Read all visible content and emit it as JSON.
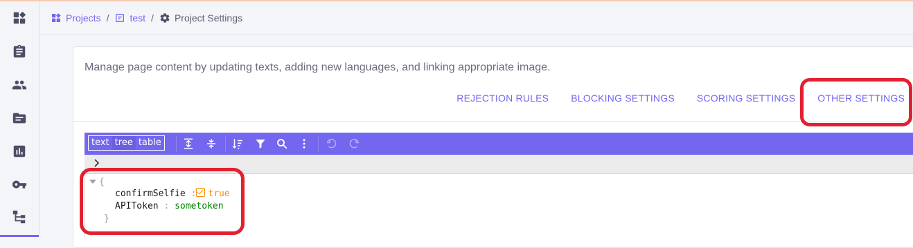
{
  "sidebar": {
    "items": [
      {
        "icon": "dashboard-icon"
      },
      {
        "icon": "clipboard-icon"
      },
      {
        "icon": "users-icon"
      },
      {
        "icon": "folder-icon"
      },
      {
        "icon": "bar-chart-icon"
      },
      {
        "icon": "key-icon"
      },
      {
        "icon": "hierarchy-icon"
      }
    ]
  },
  "breadcrumb": {
    "projects": "Projects",
    "sep1": "/",
    "project": "test",
    "sep2": "/",
    "current": "Project Settings"
  },
  "card": {
    "description": "Manage page content by updating texts, adding new languages, and linking appropriate image.",
    "tabs": [
      "REJECTION RULES",
      "BLOCKING SETTINGS",
      "SCORING SETTINGS",
      "OTHER SETTINGS"
    ],
    "active_tab": "OTHER SETTINGS"
  },
  "editor": {
    "modes": [
      "text",
      "tree",
      "table"
    ],
    "active_mode": "tree",
    "open_brace": "{",
    "close_brace": "}",
    "entries": [
      {
        "key": "confirmSelfie",
        "colon": ":",
        "value": "true",
        "type": "boolean"
      },
      {
        "key": "APIToken",
        "colon": ":",
        "value": "sometoken",
        "type": "string"
      }
    ],
    "toolbar_icons": [
      "expand-all-icon",
      "collapse-all-icon",
      "sort-icon",
      "filter-icon",
      "search-icon",
      "more-vertical-icon",
      "undo-icon",
      "redo-icon"
    ]
  },
  "colors": {
    "accent": "#7367f0",
    "highlight": "#e3202f",
    "bool": "#ff8c00",
    "string": "#008000"
  }
}
